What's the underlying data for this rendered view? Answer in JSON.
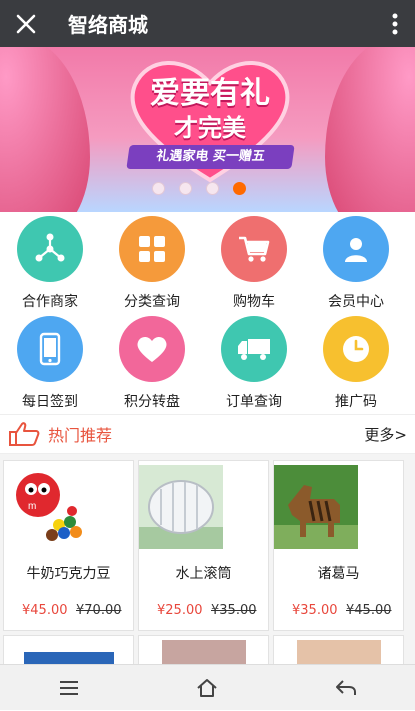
{
  "header": {
    "title": "智络商城"
  },
  "banner": {
    "slogan_line1": "爱要有礼",
    "slogan_line2": "才完美",
    "tagline": "礼遇家电 买一赠五",
    "dot_count": 4,
    "active_dot_index": 3
  },
  "grid_items": [
    {
      "label": "合作商家",
      "color": "#3fc7b0",
      "icon": "share-nodes-icon"
    },
    {
      "label": "分类查询",
      "color": "#f59a3b",
      "icon": "grid-squares-icon"
    },
    {
      "label": "购物车",
      "color": "#ef6f6f",
      "icon": "shopping-cart-icon"
    },
    {
      "label": "会员中心",
      "color": "#4ea7f1",
      "icon": "user-icon"
    },
    {
      "label": "每日签到",
      "color": "#4ea7f1",
      "icon": "smartphone-icon"
    },
    {
      "label": "积分转盘",
      "color": "#f2679a",
      "icon": "heart-icon"
    },
    {
      "label": "订单查询",
      "color": "#3fc7b0",
      "icon": "truck-icon"
    },
    {
      "label": "推广码",
      "color": "#f7c02f",
      "icon": "clock-icon"
    }
  ],
  "section": {
    "title": "热门推荐",
    "more": "更多>",
    "accent": "#e8543e"
  },
  "products": [
    {
      "name": "牛奶巧克力豆",
      "price": "¥45.00",
      "old_price": "¥70.00",
      "image": "chocolate-candy-image"
    },
    {
      "name": "水上滚筒",
      "price": "¥25.00",
      "old_price": "¥35.00",
      "image": "water-roller-image"
    },
    {
      "name": "诸葛马",
      "price": "¥35.00",
      "old_price": "¥45.00",
      "image": "toy-horse-image"
    }
  ],
  "navbar": {
    "items": [
      "menu-icon",
      "home-icon",
      "back-icon"
    ]
  }
}
